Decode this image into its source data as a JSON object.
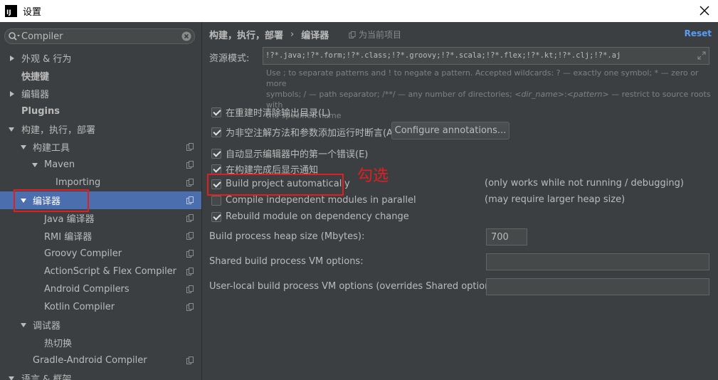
{
  "window": {
    "title": "设置",
    "app_icon_text": "IJ"
  },
  "search": {
    "value": "Compiler"
  },
  "sidebar": {
    "items": [
      {
        "label": "外观 & 行为",
        "arrow": "right"
      },
      {
        "label": "快捷键",
        "arrow": ""
      },
      {
        "label": "编辑器",
        "arrow": "right"
      },
      {
        "label": "Plugins",
        "arrow": ""
      },
      {
        "label": "构建，执行，部署",
        "arrow": "down"
      },
      {
        "label": "构建工具",
        "arrow": "down"
      },
      {
        "label": "Maven",
        "arrow": "down"
      },
      {
        "label": "Importing",
        "arrow": ""
      },
      {
        "label": "编译器",
        "arrow": "down",
        "selected": true
      },
      {
        "label": "Java 编译器",
        "arrow": ""
      },
      {
        "label": "RMI 编译器",
        "arrow": ""
      },
      {
        "label": "Groovy Compiler",
        "arrow": ""
      },
      {
        "label": "ActionScript & Flex Compiler",
        "arrow": ""
      },
      {
        "label": "Android Compilers",
        "arrow": ""
      },
      {
        "label": "Kotlin Compiler",
        "arrow": ""
      },
      {
        "label": "调试器",
        "arrow": "down"
      },
      {
        "label": "热切换",
        "arrow": ""
      },
      {
        "label": "Gradle-Android Compiler",
        "arrow": ""
      },
      {
        "label": "语言 & 框架",
        "arrow": "down"
      }
    ]
  },
  "header": {
    "crumb_parent": "构建，执行，部署",
    "crumb_separator": "›",
    "crumb_current": "编译器",
    "for_project": "为当前项目",
    "reset": "Reset"
  },
  "resource": {
    "label": "资源模式:",
    "value": "!?*.java;!?*.form;!?*.class;!?*.groovy;!?*.scala;!?*.flex;!?*.kt;!?*.clj;!?*.aj",
    "hint_line1": "Use ; to separate patterns and ! to negate a pattern. Accepted wildcards: ? — exactly one symbol; * — zero or more",
    "hint_line2_a": "symbols; / — path separator; /**/ — any number of directories; ",
    "hint_line2_b": "<dir_name>",
    "hint_line2_c": ":",
    "hint_line2_d": "<pattern>",
    "hint_line2_e": " — restrict to source roots with",
    "hint_line3": "the specified name"
  },
  "options": {
    "clear_output": {
      "label": "在重建时清除输出目录(L)",
      "checked": true
    },
    "add_assertions": {
      "label": "为非空注解方法和参数添加运行时断言(A)",
      "checked": true
    },
    "configure_button": "Configure annotations...",
    "show_first_error": {
      "label": "自动显示编辑器中的第一个错误(E)",
      "checked": true
    },
    "notify_after_build": {
      "label": "在构建完成后显示通知",
      "checked": true
    },
    "build_auto": {
      "label": "Build project automatically",
      "checked": true,
      "note": "(only works while not running / debugging)"
    },
    "compile_parallel": {
      "label": "Compile independent modules in parallel",
      "checked": false,
      "note": "(may require larger heap size)"
    },
    "rebuild_on_change": {
      "label": "Rebuild module on dependency change",
      "checked": true
    }
  },
  "annotation_text": "勾选",
  "fields": {
    "heap_label": "Build process heap size (Mbytes):",
    "heap_value": "700",
    "shared_vm_label": "Shared build process VM options:",
    "shared_vm_value": "",
    "user_vm_label": "User-local build process VM options (overrides Shared options):",
    "user_vm_value": ""
  },
  "colors": {
    "background": "#3c3f41",
    "selection": "#4b6eaf",
    "link": "#589df6",
    "annotation": "#e02020"
  }
}
